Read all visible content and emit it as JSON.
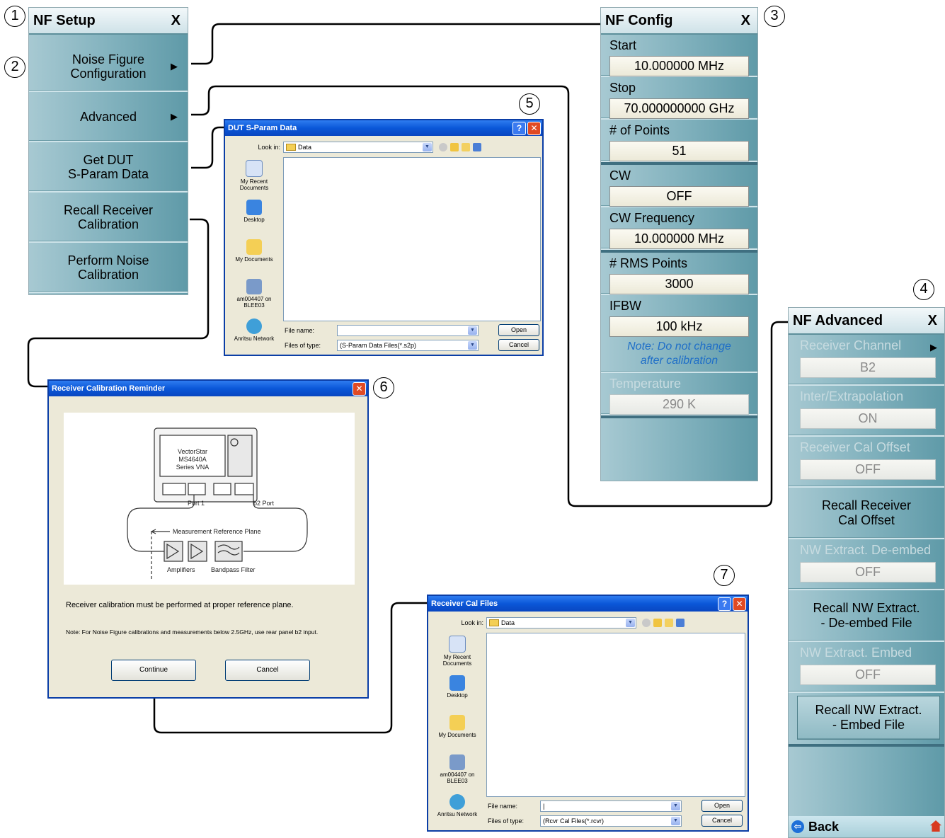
{
  "callouts": [
    "1",
    "2",
    "3",
    "4",
    "5",
    "6",
    "7"
  ],
  "nf_setup": {
    "title": "NF Setup",
    "close": "X",
    "buttons": [
      {
        "label": "Noise Figure\nConfiguration",
        "arrow": "▶"
      },
      {
        "label": "Advanced",
        "arrow": "▶"
      },
      {
        "label": "Get DUT\nS-Param Data",
        "arrow": ""
      },
      {
        "label": "Recall Receiver\nCalibration",
        "arrow": ""
      },
      {
        "label": "Perform Noise\nCalibration",
        "arrow": ""
      }
    ]
  },
  "nf_config": {
    "title": "NF Config",
    "close": "X",
    "fields": [
      {
        "label": "Start",
        "value": "10.000000 MHz"
      },
      {
        "label": "Stop",
        "value": "70.000000000 GHz"
      },
      {
        "label": "# of Points",
        "value": "51"
      },
      {
        "label": "CW",
        "value": "OFF"
      },
      {
        "label": "CW Frequency",
        "value": "10.000000 MHz"
      },
      {
        "label": "# RMS Points",
        "value": "3000"
      },
      {
        "label": "IFBW",
        "value": "100 kHz"
      },
      {
        "label": "Temperature",
        "value": "290  K"
      }
    ],
    "note": "Note: Do not change\nafter calibration"
  },
  "nf_advanced": {
    "title": "NF Advanced",
    "close": "X",
    "fields": [
      {
        "label": "Receiver Channel",
        "value": "B2",
        "arrow": "▶"
      },
      {
        "label": "Inter/Extrapolation",
        "value": "ON"
      },
      {
        "label": "Receiver Cal Offset",
        "value": "OFF"
      }
    ],
    "recall_offset": "Recall Receiver\nCal Offset",
    "deembed_field": {
      "label": "NW Extract. De-embed",
      "value": "OFF"
    },
    "recall_deembed": "Recall NW Extract.\n- De-embed File",
    "embed_field": {
      "label": "NW Extract. Embed",
      "value": "OFF"
    },
    "recall_embed": "Recall NW Extract.\n- Embed File",
    "back": "Back"
  },
  "dut_dialog": {
    "title": "DUT S-Param Data",
    "look_in_label": "Look in:",
    "look_in_value": "Data",
    "places": [
      "My Recent\nDocuments",
      "Desktop",
      "My Documents",
      "am004407 on\nBLEE03",
      "Anritsu Network"
    ],
    "file_name_label": "File name:",
    "file_name_value": "",
    "file_type_label": "Files of type:",
    "file_type_value": "(S-Param Data Files(*.s2p)",
    "open": "Open",
    "cancel": "Cancel"
  },
  "reminder_dialog": {
    "title": "Receiver Calibration Reminder",
    "vna_label": "VectorStar\nMS4640A\nSeries VNA",
    "port1": "Port 1",
    "b2port": "b2 Port",
    "ref_plane": "Measurement Reference Plane",
    "amplifiers": "Amplifiers",
    "bandpass": "Bandpass Filter",
    "message": "Receiver calibration must be performed at proper reference plane.",
    "note": "Note: For Noise Figure calibrations and measurements below 2.5GHz, use rear panel b2 input.",
    "continue": "Continue",
    "cancel": "Cancel"
  },
  "rcvr_dialog": {
    "title": "Receiver Cal Files",
    "look_in_label": "Look in:",
    "look_in_value": "Data",
    "places": [
      "My Recent\nDocuments",
      "Desktop",
      "My Documents",
      "am004407 on\nBLEE03",
      "Anritsu Network"
    ],
    "file_name_label": "File name:",
    "file_name_value": "|",
    "file_type_label": "Files of type:",
    "file_type_value": "(Rcvr Cal Files(*.rcvr)",
    "open": "Open",
    "cancel": "Cancel"
  },
  "colors": {
    "panel": "#7fb0bc",
    "xp_title": "#0a57d8",
    "note": "#1e6ec8"
  },
  "icons": [
    "folder-icon",
    "up-folder-icon",
    "new-folder-icon",
    "views-icon",
    "back-icon",
    "home-icon",
    "arrow-right-icon",
    "help-icon",
    "close-icon"
  ]
}
